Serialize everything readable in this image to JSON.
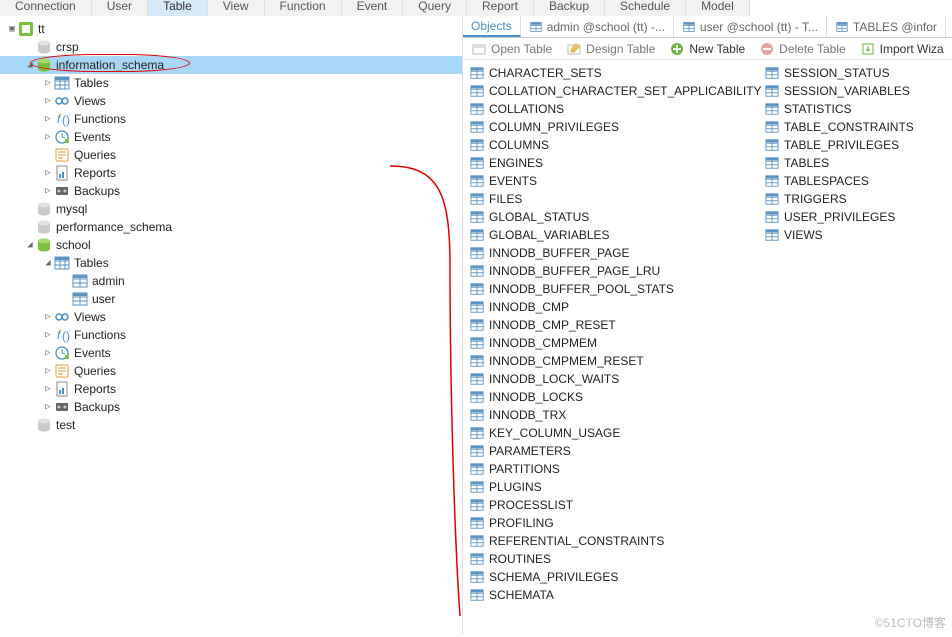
{
  "ribbon": {
    "items": [
      "Connection",
      "User",
      "Table",
      "View",
      "Function",
      "Event",
      "Query",
      "Report",
      "Backup",
      "Schedule",
      "Model"
    ],
    "active_index": 2
  },
  "tree": {
    "root": "tt",
    "items": [
      {
        "level": 0,
        "toggle": "▣",
        "icon": "conn",
        "label": "tt"
      },
      {
        "level": 1,
        "toggle": "",
        "icon": "db-off",
        "label": "crsp"
      },
      {
        "level": 1,
        "toggle": "◢",
        "icon": "db",
        "label": "information_schema",
        "selected": true,
        "annot": "oval"
      },
      {
        "level": 2,
        "toggle": "▷",
        "icon": "tables",
        "label": "Tables"
      },
      {
        "level": 2,
        "toggle": "▷",
        "icon": "views",
        "label": "Views"
      },
      {
        "level": 2,
        "toggle": "▷",
        "icon": "func",
        "label": "Functions"
      },
      {
        "level": 2,
        "toggle": "▷",
        "icon": "event",
        "label": "Events"
      },
      {
        "level": 2,
        "toggle": "",
        "icon": "query",
        "label": "Queries"
      },
      {
        "level": 2,
        "toggle": "▷",
        "icon": "report",
        "label": "Reports"
      },
      {
        "level": 2,
        "toggle": "▷",
        "icon": "backup",
        "label": "Backups"
      },
      {
        "level": 1,
        "toggle": "",
        "icon": "db-off",
        "label": "mysql"
      },
      {
        "level": 1,
        "toggle": "",
        "icon": "db-off",
        "label": "performance_schema"
      },
      {
        "level": 1,
        "toggle": "◢",
        "icon": "db",
        "label": "school"
      },
      {
        "level": 2,
        "toggle": "◢",
        "icon": "tables",
        "label": "Tables"
      },
      {
        "level": 3,
        "toggle": "",
        "icon": "table",
        "label": "admin"
      },
      {
        "level": 3,
        "toggle": "",
        "icon": "table",
        "label": "user"
      },
      {
        "level": 2,
        "toggle": "▷",
        "icon": "views",
        "label": "Views"
      },
      {
        "level": 2,
        "toggle": "▷",
        "icon": "func",
        "label": "Functions"
      },
      {
        "level": 2,
        "toggle": "▷",
        "icon": "event",
        "label": "Events"
      },
      {
        "level": 2,
        "toggle": "▷",
        "icon": "query",
        "label": "Queries"
      },
      {
        "level": 2,
        "toggle": "▷",
        "icon": "report",
        "label": "Reports"
      },
      {
        "level": 2,
        "toggle": "▷",
        "icon": "backup",
        "label": "Backups"
      },
      {
        "level": 1,
        "toggle": "",
        "icon": "db-off",
        "label": "test"
      }
    ]
  },
  "maintabs": {
    "items": [
      {
        "icon": "",
        "label": "Objects",
        "active": true
      },
      {
        "icon": "table",
        "label": "admin @school (tt) -..."
      },
      {
        "icon": "table",
        "label": "user @school (tt) - T..."
      },
      {
        "icon": "table",
        "label": "TABLES @infor"
      }
    ]
  },
  "toolbar": {
    "open": "Open Table",
    "design": "Design Table",
    "newt": "New Table",
    "deletet": "Delete Table",
    "importw": "Import Wiza"
  },
  "tables": {
    "col1": [
      "CHARACTER_SETS",
      "COLLATION_CHARACTER_SET_APPLICABILITY",
      "COLLATIONS",
      "COLUMN_PRIVILEGES",
      "COLUMNS",
      "ENGINES",
      "EVENTS",
      "FILES",
      "GLOBAL_STATUS",
      "GLOBAL_VARIABLES",
      "INNODB_BUFFER_PAGE",
      "INNODB_BUFFER_PAGE_LRU",
      "INNODB_BUFFER_POOL_STATS",
      "INNODB_CMP",
      "INNODB_CMP_RESET",
      "INNODB_CMPMEM",
      "INNODB_CMPMEM_RESET",
      "INNODB_LOCK_WAITS",
      "INNODB_LOCKS",
      "INNODB_TRX",
      "KEY_COLUMN_USAGE",
      "PARAMETERS",
      "PARTITIONS",
      "PLUGINS",
      "PROCESSLIST",
      "PROFILING",
      "REFERENTIAL_CONSTRAINTS",
      "ROUTINES",
      "SCHEMA_PRIVILEGES",
      "SCHEMATA"
    ],
    "col2": [
      "SESSION_STATUS",
      "SESSION_VARIABLES",
      "STATISTICS",
      "TABLE_CONSTRAINTS",
      "TABLE_PRIVILEGES",
      "TABLES",
      "TABLESPACES",
      "TRIGGERS",
      "USER_PRIVILEGES",
      "VIEWS"
    ]
  },
  "watermark": "©51CTO博客"
}
